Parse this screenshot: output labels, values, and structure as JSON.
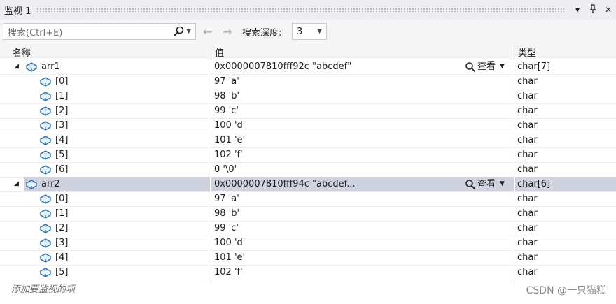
{
  "window": {
    "title": "监视 1",
    "dropdown_icon": "caret-down-icon",
    "pin_icon": "pin-icon",
    "close_icon": "close-icon"
  },
  "toolbar": {
    "search_placeholder": "搜索(Ctrl+E)",
    "search_icon": "search-icon",
    "back_icon": "arrow-left-icon",
    "forward_icon": "arrow-right-icon",
    "depth_label": "搜索深度:",
    "depth_value": "3"
  },
  "columns": {
    "name": "名称",
    "value": "值",
    "type": "类型"
  },
  "view_label": "查看",
  "rows": [
    {
      "name": "arr1",
      "value": "0x0000007810fff92c \"abcdef\"",
      "type": "char[7]",
      "level": 0,
      "expanded": true,
      "view": true,
      "selected": false
    },
    {
      "name": "[0]",
      "value": "97 'a'",
      "type": "char",
      "level": 1
    },
    {
      "name": "[1]",
      "value": "98 'b'",
      "type": "char",
      "level": 1
    },
    {
      "name": "[2]",
      "value": "99 'c'",
      "type": "char",
      "level": 1
    },
    {
      "name": "[3]",
      "value": "100 'd'",
      "type": "char",
      "level": 1
    },
    {
      "name": "[4]",
      "value": "101 'e'",
      "type": "char",
      "level": 1
    },
    {
      "name": "[5]",
      "value": "102 'f'",
      "type": "char",
      "level": 1
    },
    {
      "name": "[6]",
      "value": "0 '\\0'",
      "type": "char",
      "level": 1
    },
    {
      "name": "arr2",
      "value": "0x0000007810fff94c \"abcdef...",
      "type": "char[6]",
      "level": 0,
      "expanded": true,
      "view": true,
      "selected": true
    },
    {
      "name": "[0]",
      "value": "97 'a'",
      "type": "char",
      "level": 1
    },
    {
      "name": "[1]",
      "value": "98 'b'",
      "type": "char",
      "level": 1
    },
    {
      "name": "[2]",
      "value": "99 'c'",
      "type": "char",
      "level": 1
    },
    {
      "name": "[3]",
      "value": "100 'd'",
      "type": "char",
      "level": 1
    },
    {
      "name": "[4]",
      "value": "101 'e'",
      "type": "char",
      "level": 1
    },
    {
      "name": "[5]",
      "value": "102 'f'",
      "type": "char",
      "level": 1
    }
  ],
  "add_watch_hint": "添加要监视的项",
  "watermark": "CSDN @一只猫糕",
  "colors": {
    "selected_row": "#cfd3e0",
    "icon_blue": "#1f6fb5",
    "icon_fill": "#cfe3f5"
  }
}
